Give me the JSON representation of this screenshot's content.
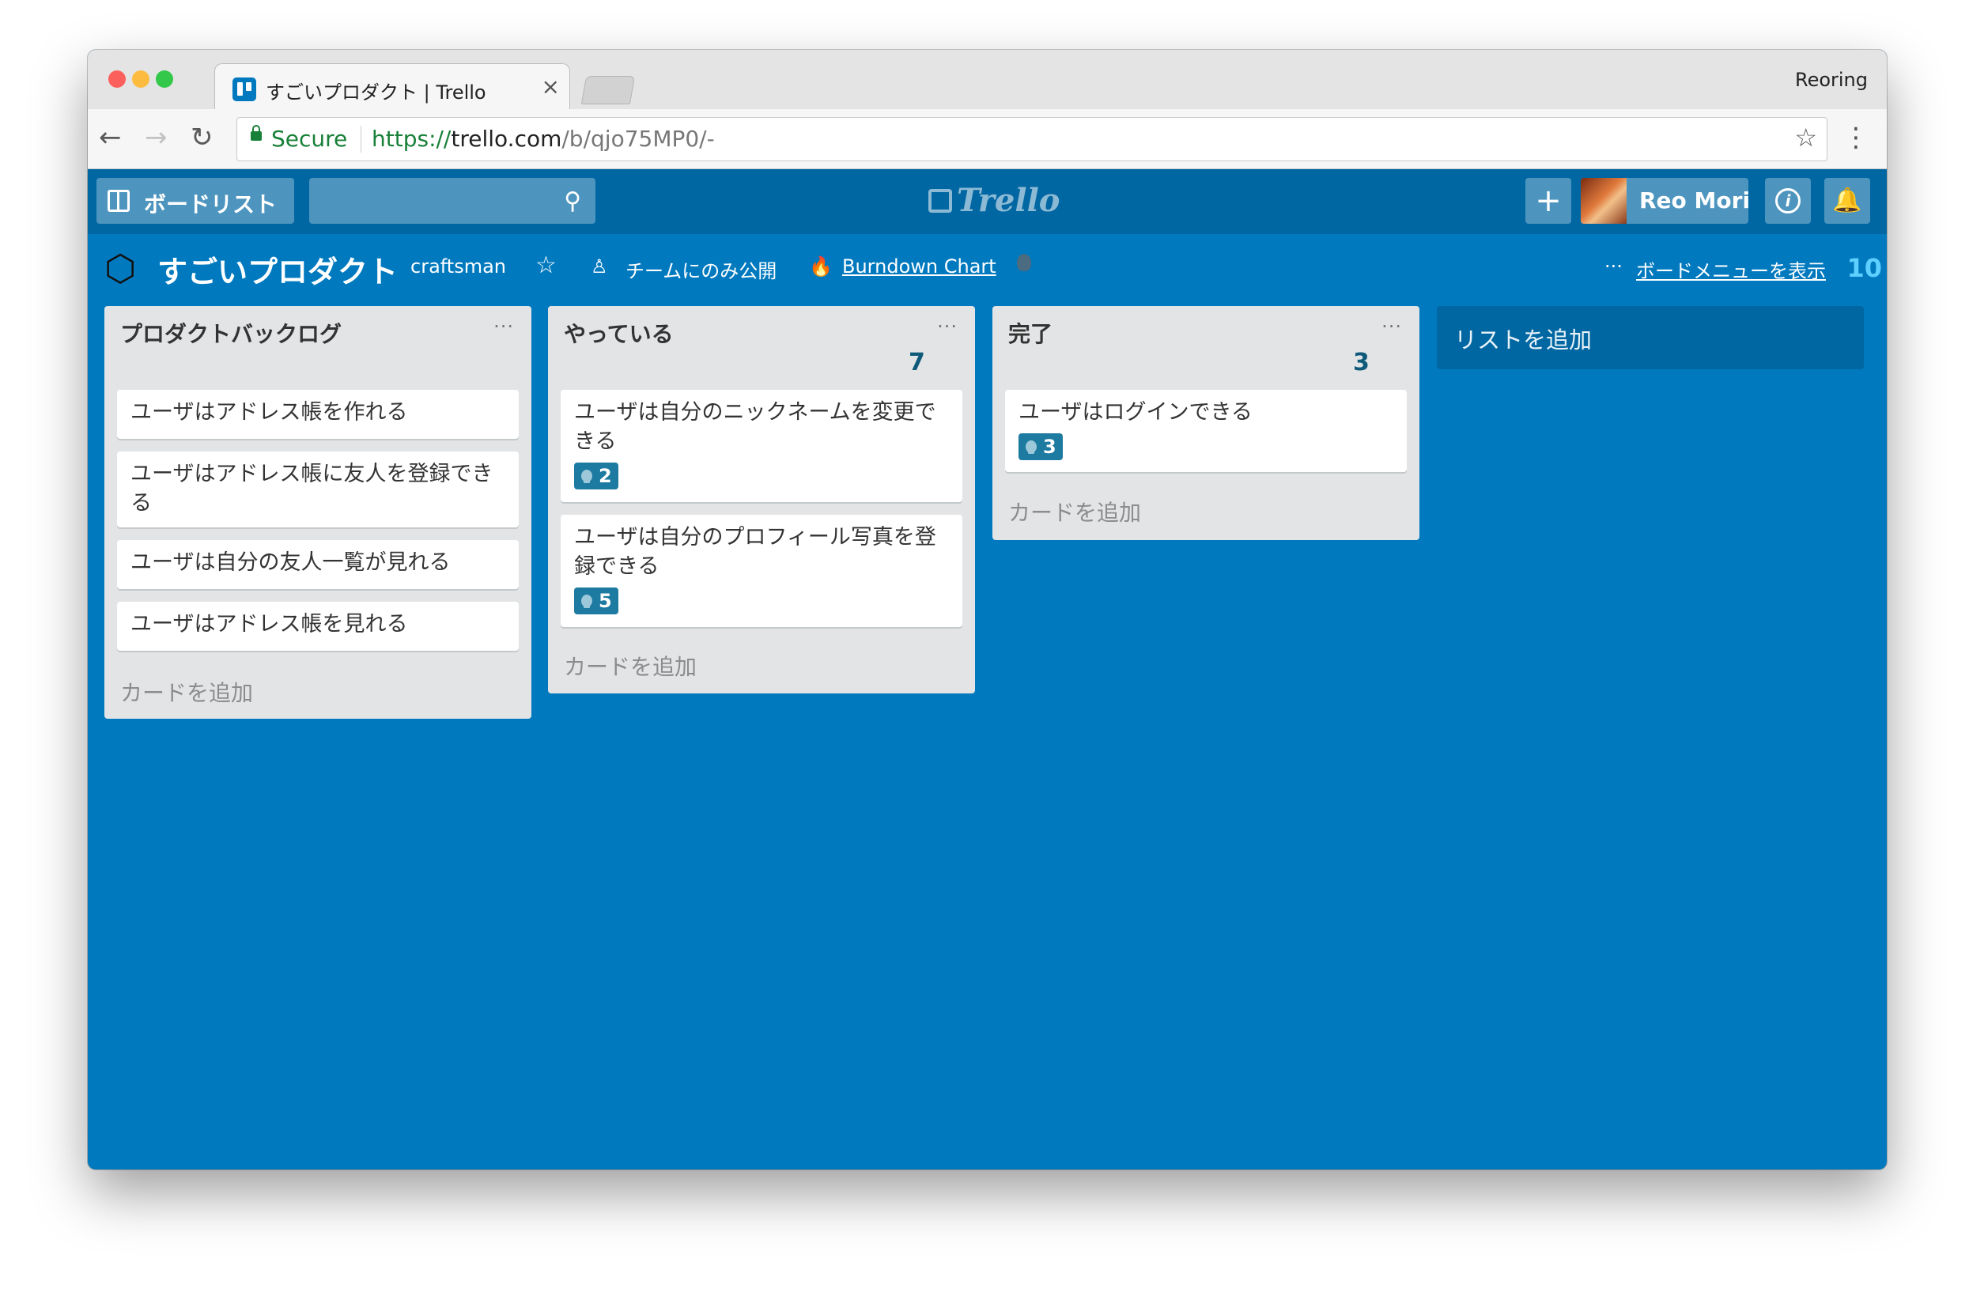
{
  "browser": {
    "tab_title": "すごいプロダクト | Trello",
    "tab_close": "×",
    "profile_name": "Reoring",
    "secure_label": "Secure",
    "url_scheme": "https://",
    "url_host": "trello.com",
    "url_path": "/b/qjo75MP0/-",
    "back_icon": "←",
    "forward_icon": "→",
    "reload_icon": "↻",
    "bookmark_icon": "☆",
    "menu_icon": "⋮"
  },
  "header": {
    "boards_label": "ボードリスト",
    "logo_text": "Trello",
    "plus_icon": "+",
    "user_name": "Reo Mori",
    "info_icon": "i",
    "bell_icon": "🔔",
    "search_icon": "⚲"
  },
  "board": {
    "name": "すごいプロダクト",
    "team": "craftsman",
    "star_icon": "☆",
    "visibility": "チームにのみ公開",
    "visibility_icon": "♙",
    "fire_icon": "🔥",
    "powerup_link": "Burndown Chart",
    "menu_dots": "···",
    "menu_label": "ボードメニューを表示",
    "total_count": "10"
  },
  "lists": [
    {
      "title": "プロダクトバックログ",
      "menu": "···",
      "cards": [
        {
          "title": "ユーザはアドレス帳を作れる"
        },
        {
          "title": "ユーザはアドレス帳に友人を登録できる"
        },
        {
          "title": "ユーザは自分の友人一覧が見れる"
        },
        {
          "title": "ユーザはアドレス帳を見れる"
        }
      ],
      "add_card": "カードを追加"
    },
    {
      "title": "やっている",
      "menu": "···",
      "count": "7",
      "cards": [
        {
          "title": "ユーザは自分のニックネームを変更できる",
          "badge": "2"
        },
        {
          "title": "ユーザは自分のプロフィール写真を登録できる",
          "badge": "5"
        }
      ],
      "add_card": "カードを追加"
    },
    {
      "title": "完了",
      "menu": "···",
      "count": "3",
      "cards": [
        {
          "title": "ユーザはログインできる",
          "badge": "3"
        }
      ],
      "add_card": "カードを追加"
    }
  ],
  "add_list": "リストを追加",
  "colors": {
    "board_bg": "#0079bf",
    "header_bg": "#0067a3",
    "list_bg": "#e2e4e6",
    "badge_bg": "#1d7aa0",
    "count_color": "#5ed0ff"
  }
}
